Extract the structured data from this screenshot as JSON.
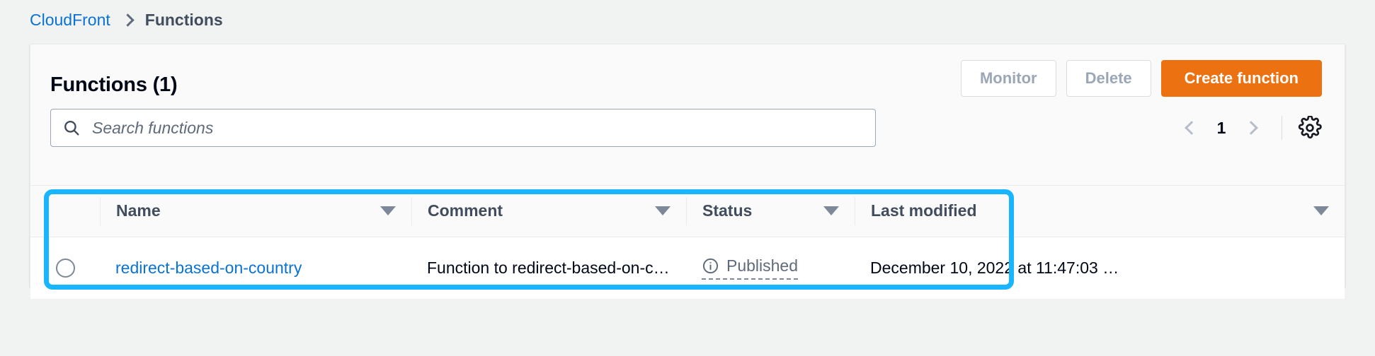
{
  "breadcrumb": {
    "root": "CloudFront",
    "separator_icon": "chevron-right-icon",
    "current": "Functions"
  },
  "panel": {
    "title": "Functions (1)",
    "actions": {
      "monitor": "Monitor",
      "delete": "Delete",
      "create": "Create function"
    },
    "search": {
      "placeholder": "Search functions",
      "value": "",
      "icon": "search-icon"
    },
    "pagination": {
      "prev_icon": "chevron-left-icon",
      "next_icon": "chevron-right-icon",
      "current_page": "1"
    },
    "preferences": {
      "icon": "gear-icon"
    }
  },
  "table": {
    "columns": [
      {
        "label": "Name",
        "sort_icon": "sort-triangle-icon"
      },
      {
        "label": "Comment",
        "sort_icon": "sort-triangle-icon"
      },
      {
        "label": "Status",
        "sort_icon": "sort-triangle-icon"
      },
      {
        "label": "Last modified",
        "sort_icon": "sort-triangle-icon"
      }
    ],
    "rows": [
      {
        "selected": false,
        "name": "redirect-based-on-country",
        "comment": "Function to redirect-based-on-co…",
        "status": "Published",
        "status_icon": "info-icon",
        "last_modified": "December 10, 2022 at 11:47:03 …"
      }
    ]
  },
  "colors": {
    "link": "#0972d3",
    "primary_button": "#ec7211",
    "annotation_highlight": "#19b5fe",
    "page_background": "#f1f3f3"
  }
}
